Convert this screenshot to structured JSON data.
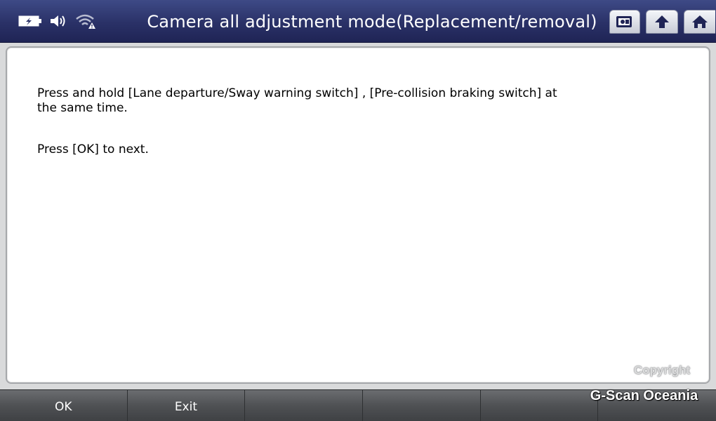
{
  "header": {
    "title": "Camera all adjustment mode(Replacement/removal)",
    "status_icons": [
      "battery-icon",
      "speaker-icon",
      "wifi-warning-icon"
    ],
    "buttons": [
      "screenshot-icon",
      "back-arrow-icon",
      "home-icon"
    ]
  },
  "message": {
    "line1": "Press and hold [Lane departure/Sway warning switch] , [Pre-collision braking switch] at\nthe same time.",
    "line2": "Press [OK] to next."
  },
  "function_keys": {
    "f1": "OK",
    "f2": "Exit",
    "f3": "",
    "f4": "",
    "f5": "",
    "f6": ""
  },
  "watermark": {
    "copyright": "Copyright",
    "brand": "G-Scan Oceania"
  },
  "colors": {
    "titlebar": "#2a3167",
    "panel_bg": "#ffffff",
    "function_bar": "#4f5154"
  }
}
